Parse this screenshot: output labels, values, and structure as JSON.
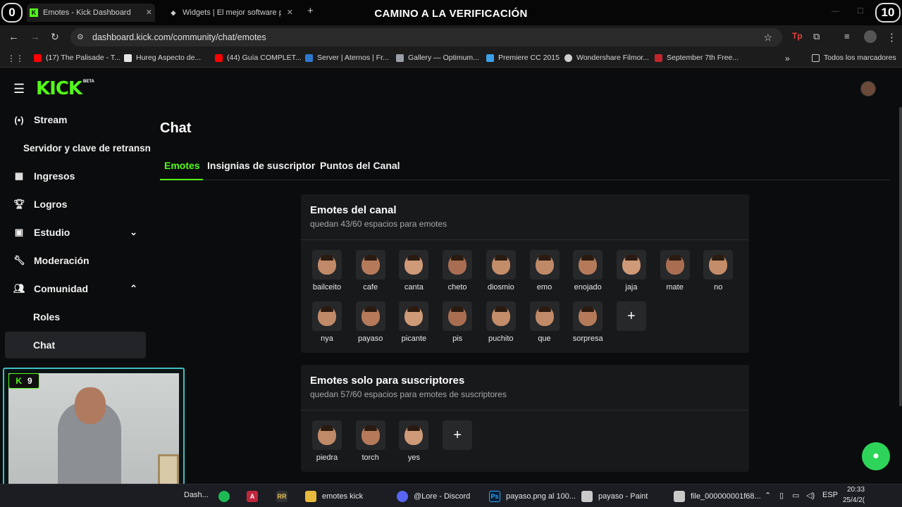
{
  "browser": {
    "tabs": [
      {
        "title": "Emotes - Kick Dashboard",
        "active": true
      },
      {
        "title": "Widgets | El mejor software pa",
        "active": false
      }
    ],
    "new_tab": "+",
    "overlay_title": "CAMINO A LA VERIFICACIÓN",
    "counter_left": "0",
    "counter_right": "10",
    "url": "dashboard.kick.com/community/chat/emotes",
    "bookmarks": [
      {
        "label": "(17) The Palisade - T...",
        "icon": "youtube-icon",
        "color": "#ff0000"
      },
      {
        "label": "Hureg Aspecto de...",
        "icon": "page-icon",
        "color": "#e6e6e6"
      },
      {
        "label": "(44) Guía COMPLET...",
        "icon": "youtube-icon",
        "color": "#ff0000"
      },
      {
        "label": "Server | Aternos | Fr...",
        "icon": "aternos-icon",
        "color": "#2f78d0"
      },
      {
        "label": "Gallery — Optimum...",
        "icon": "gallery-icon",
        "color": "#9aa0a6"
      },
      {
        "label": "Premiere CC 2015",
        "icon": "premiere-icon",
        "color": "#3aa0e8"
      },
      {
        "label": "Wondershare Filmor...",
        "icon": "globe-icon",
        "color": "#cfcfcf"
      },
      {
        "label": "September 7th Free...",
        "icon": "bookmark-red-icon",
        "color": "#c0262c"
      }
    ],
    "all_bookmarks": "Todos los marcadores"
  },
  "brand": {
    "logo": "KICK",
    "beta": "BETA",
    "accent": "#53fc18"
  },
  "sidebar": {
    "items": [
      {
        "label": "Stream",
        "icon": "broadcast-icon"
      },
      {
        "label": "Servidor y clave de retransn",
        "icon": ""
      },
      {
        "label": "Ingresos",
        "icon": "chart-icon"
      },
      {
        "label": "Logros",
        "icon": "trophy-icon"
      },
      {
        "label": "Estudio",
        "icon": "studio-icon"
      },
      {
        "label": "Moderación",
        "icon": "wrench-icon"
      },
      {
        "label": "Comunidad",
        "icon": "users-icon"
      },
      {
        "label": "Roles",
        "icon": ""
      },
      {
        "label": "Chat",
        "icon": ""
      }
    ]
  },
  "main": {
    "title": "Chat",
    "tabs": [
      {
        "label": "Emotes",
        "active": true
      },
      {
        "label": "Insignias de suscriptor",
        "active": false
      },
      {
        "label": "Puntos del Canal",
        "active": false
      }
    ]
  },
  "channel_emotes": {
    "title": "Emotes del canal",
    "subtitle": "quedan 43/60 espacios para emotes",
    "emotes": [
      "bailceito",
      "cafe",
      "canta",
      "cheto",
      "diosmio",
      "emo",
      "enojado",
      "jaja",
      "mate",
      "no",
      "nya",
      "payaso",
      "picante",
      "pis",
      "puchito",
      "que",
      "sorpresa"
    ],
    "add_label": "+"
  },
  "sub_emotes": {
    "title": "Emotes solo para suscriptores",
    "subtitle": "quedan 57/60 espacios para emotes de suscriptores",
    "emotes": [
      "piedra",
      "torch",
      "yes"
    ],
    "add_label": "+"
  },
  "webcam": {
    "badge": "9"
  },
  "taskbar": {
    "items": [
      {
        "label": "Dash...",
        "icon": "kick-icon"
      },
      {
        "label": "",
        "icon": "spotify-icon"
      },
      {
        "label": "",
        "icon": "app-a-icon"
      },
      {
        "label": "",
        "icon": "app-rr-icon"
      },
      {
        "label": "emotes kick",
        "icon": "folder-icon"
      },
      {
        "label": "@Lore - Discord",
        "icon": "discord-icon"
      },
      {
        "label": "payaso.png al 100...",
        "icon": "photoshop-icon"
      },
      {
        "label": "payaso - Paint",
        "icon": "paint-icon"
      },
      {
        "label": "file_000000001f68...",
        "icon": "paint-icon"
      }
    ],
    "lang": "ESP",
    "time": "20:33",
    "date": "25/4/2("
  }
}
